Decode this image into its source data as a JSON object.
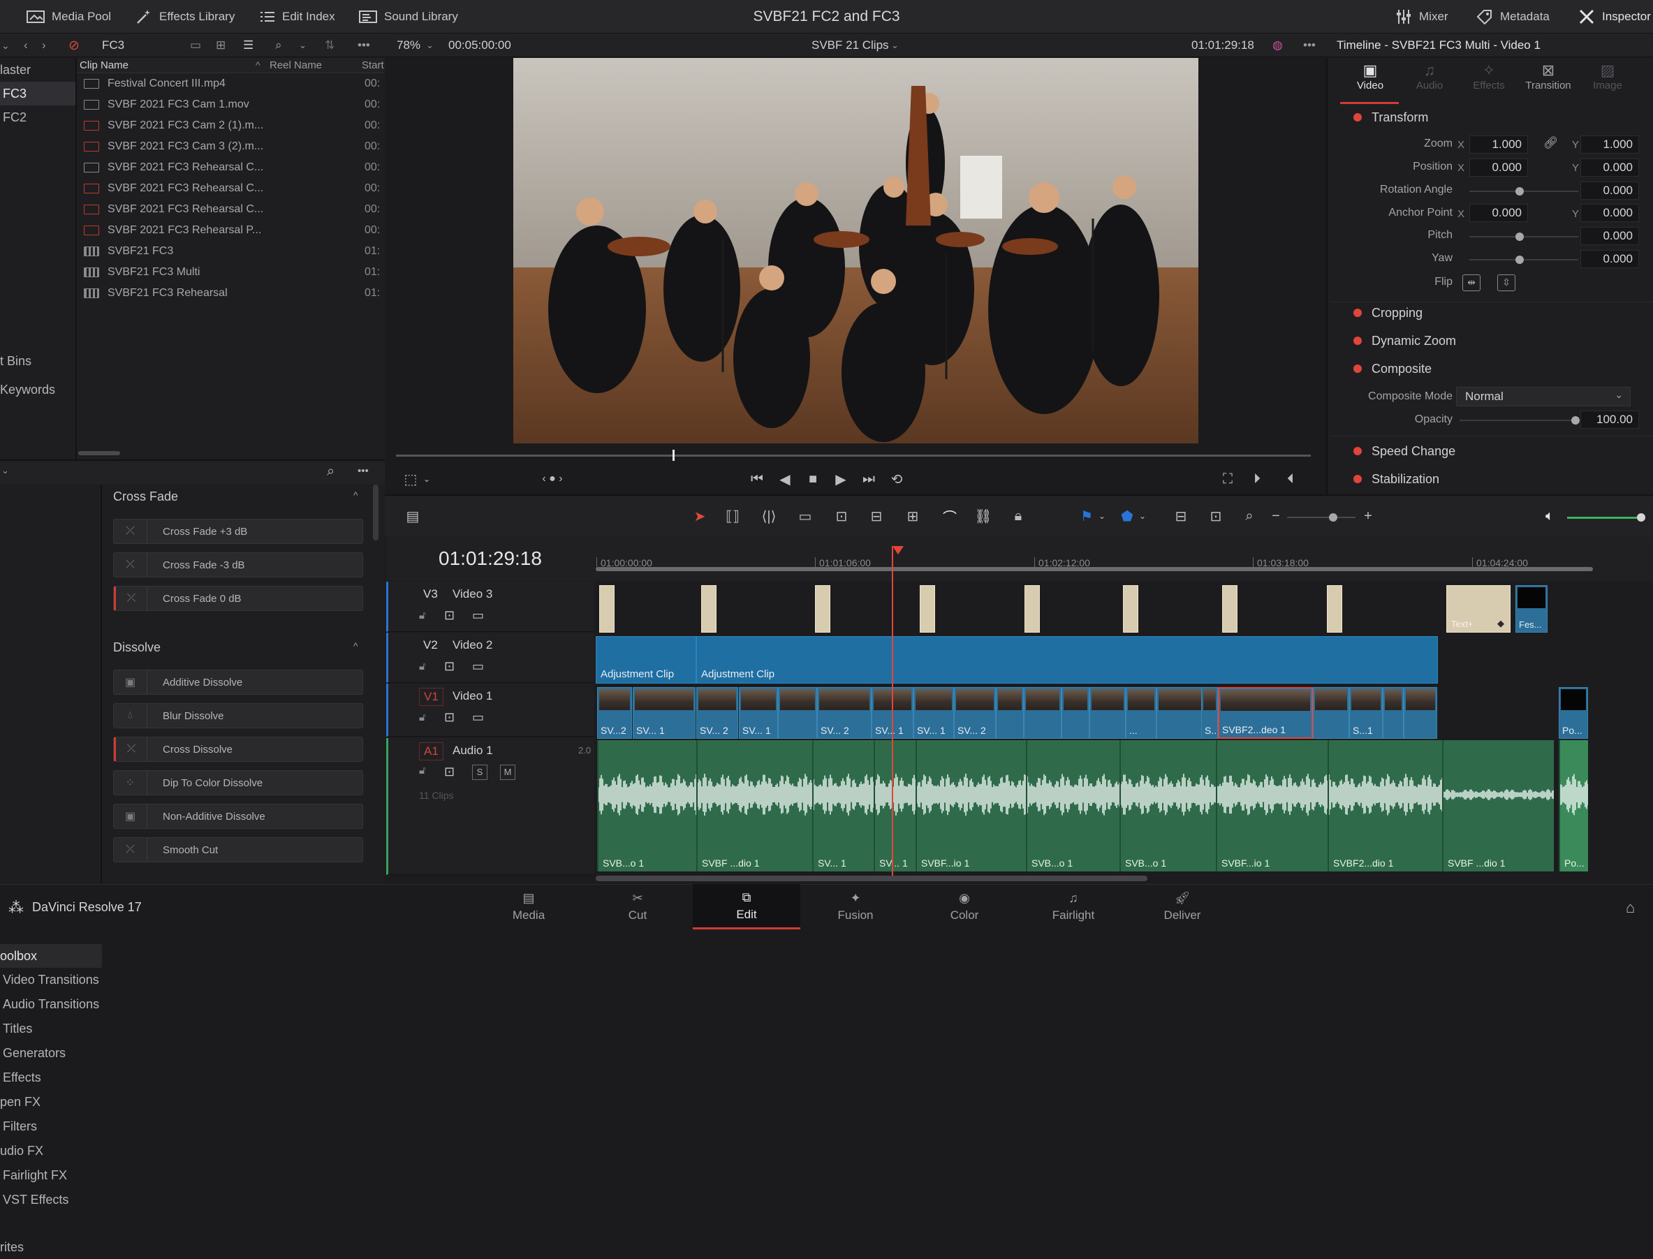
{
  "topbar": {
    "media_pool": "Media Pool",
    "effects_library": "Effects Library",
    "edit_index": "Edit Index",
    "sound_library": "Sound Library",
    "project_title": "SVBF21 FC2 and FC3",
    "mixer": "Mixer",
    "metadata": "Metadata",
    "inspector": "Inspector"
  },
  "subbar": {
    "bin_name": "FC3",
    "zoom": "78%",
    "duration": "00:05:00:00",
    "timeline_selector": "SVBF 21 Clips",
    "timecode": "01:01:29:18",
    "inspector_title": "Timeline - SVBF21 FC3 Multi - Video 1"
  },
  "bins": {
    "items": [
      "laster",
      "FC3",
      "FC2"
    ],
    "smart_bins": "t Bins",
    "keywords": "Keywords"
  },
  "media_pool": {
    "columns": [
      "Clip Name",
      "Reel Name",
      "Start"
    ],
    "clips": [
      {
        "name": "Festival Concert III.mp4",
        "start": "00:"
      },
      {
        "name": "SVBF 2021 FC3 Cam 1.mov",
        "start": "00:"
      },
      {
        "name": "SVBF 2021 FC3 Cam 2 (1).m...",
        "start": "00:"
      },
      {
        "name": "SVBF 2021 FC3 Cam 3 (2).m...",
        "start": "00:"
      },
      {
        "name": "SVBF 2021 FC3 Rehearsal C...",
        "start": "00:"
      },
      {
        "name": "SVBF 2021 FC3 Rehearsal C...",
        "start": "00:"
      },
      {
        "name": "SVBF 2021 FC3 Rehearsal C...",
        "start": "00:"
      },
      {
        "name": "SVBF 2021 FC3 Rehearsal P...",
        "start": "00:"
      },
      {
        "name": "SVBF21 FC3",
        "start": "01:"
      },
      {
        "name": "SVBF21 FC3 Multi",
        "start": "01:"
      },
      {
        "name": "SVBF21 FC3 Rehearsal",
        "start": "01:"
      }
    ]
  },
  "toolbox": {
    "items": [
      "oolbox",
      "Video Transitions",
      "Audio Transitions",
      "Titles",
      "Generators",
      "Effects",
      "pen FX",
      "Filters",
      "udio FX",
      "Fairlight FX",
      "VST Effects",
      "rites"
    ]
  },
  "effects": {
    "group1": "Cross Fade",
    "group1_items": [
      "Cross Fade +3 dB",
      "Cross Fade -3 dB",
      "Cross Fade 0 dB"
    ],
    "group2": "Dissolve",
    "group2_items": [
      "Additive Dissolve",
      "Blur Dissolve",
      "Cross Dissolve",
      "Dip To Color Dissolve",
      "Non-Additive Dissolve",
      "Smooth Cut"
    ]
  },
  "inspector": {
    "tabs": [
      "Video",
      "Audio",
      "Effects",
      "Transition",
      "Image"
    ],
    "transform": "Transform",
    "zoom_label": "Zoom",
    "zoom_x": "1.000",
    "zoom_y": "1.000",
    "position_label": "Position",
    "position_x": "0.000",
    "position_y": "0.000",
    "rotation_label": "Rotation Angle",
    "rotation": "0.000",
    "anchor_label": "Anchor Point",
    "anchor_x": "0.000",
    "anchor_y": "0.000",
    "pitch_label": "Pitch",
    "pitch": "0.000",
    "yaw_label": "Yaw",
    "yaw": "0.000",
    "flip_label": "Flip",
    "x": "X",
    "y": "Y",
    "cropping": "Cropping",
    "dynamic_zoom": "Dynamic Zoom",
    "composite": "Composite",
    "composite_mode_label": "Composite Mode",
    "composite_mode": "Normal",
    "opacity_label": "Opacity",
    "opacity": "100.00",
    "speed_change": "Speed Change",
    "stabilization": "Stabilization"
  },
  "timeline": {
    "timecode": "01:01:29:18",
    "ruler": [
      "01:00:00:00",
      "01:01:06:00",
      "01:02:12:00",
      "01:03:18:00",
      "01:04:24:00"
    ],
    "tracks": [
      {
        "id": "V3",
        "name": "Video 3"
      },
      {
        "id": "V2",
        "name": "Video 2"
      },
      {
        "id": "V1",
        "name": "Video 1"
      },
      {
        "id": "A1",
        "name": "Audio 1",
        "level": "2.0",
        "clip_count": "11 Clips"
      }
    ],
    "adjustment": "Adjustment Clip",
    "v3_text": "Text+",
    "v3_fes": "Fes...",
    "video_clips": [
      "SV...2",
      "SV... 1",
      "SV... 2",
      "SV... 1",
      "SV... 2",
      "SV... 1",
      "SV... 1",
      "SV... 2",
      "...",
      "S...1",
      "SVBF2...deo 1",
      "S...1",
      "Po..."
    ],
    "audio_clips": [
      "SVB...o 1",
      "SVBF ...dio 1",
      "SV... 1",
      "SV... 1",
      "SVBF...io 1",
      "SVB...o 1",
      "SVB...o 1",
      "SVBF...io 1",
      "SVBF2...dio 1",
      "SVBF ...dio 1",
      "Po..."
    ],
    "solo": "S",
    "mute": "M"
  },
  "pages": [
    "Media",
    "Cut",
    "Edit",
    "Fusion",
    "Color",
    "Fairlight",
    "Deliver"
  ],
  "app_name": "DaVinci Resolve 17",
  "colors": {
    "accent": "#d03c32",
    "playhead": "#e5453a",
    "clip_blue": "#2c6f98",
    "audio_green": "#2f6b4a"
  }
}
